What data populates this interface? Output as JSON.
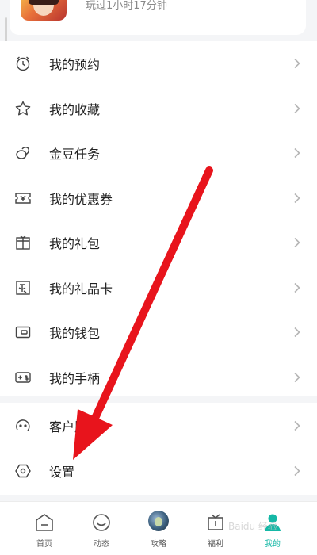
{
  "game": {
    "play_time": "玩过1小时17分钟"
  },
  "menu": {
    "items": [
      {
        "label": "我的预约",
        "icon": "alarm-clock-icon"
      },
      {
        "label": "我的收藏",
        "icon": "star-icon"
      },
      {
        "label": "金豆任务",
        "icon": "gold-bean-icon"
      },
      {
        "label": "我的优惠券",
        "icon": "coupon-icon"
      },
      {
        "label": "我的礼包",
        "icon": "gift-box-icon"
      },
      {
        "label": "我的礼品卡",
        "icon": "gift-card-icon"
      },
      {
        "label": "我的钱包",
        "icon": "wallet-icon"
      },
      {
        "label": "我的手柄",
        "icon": "gamepad-icon"
      }
    ]
  },
  "menu2": {
    "items": [
      {
        "label": "客户服务",
        "icon": "customer-service-icon"
      },
      {
        "label": "设置",
        "icon": "settings-icon"
      }
    ]
  },
  "tabbar": {
    "tabs": [
      {
        "label": "首页",
        "icon": "home-icon"
      },
      {
        "label": "动态",
        "icon": "moments-icon"
      },
      {
        "label": "攻略",
        "icon": "guide-avatar-icon"
      },
      {
        "label": "福利",
        "icon": "gift-icon"
      },
      {
        "label": "我的",
        "icon": "profile-icon"
      }
    ],
    "active_index": 4
  },
  "colors": {
    "accent": "#15b8a6",
    "annotation_arrow": "#e8141c"
  },
  "watermark": "Baidu 经验"
}
